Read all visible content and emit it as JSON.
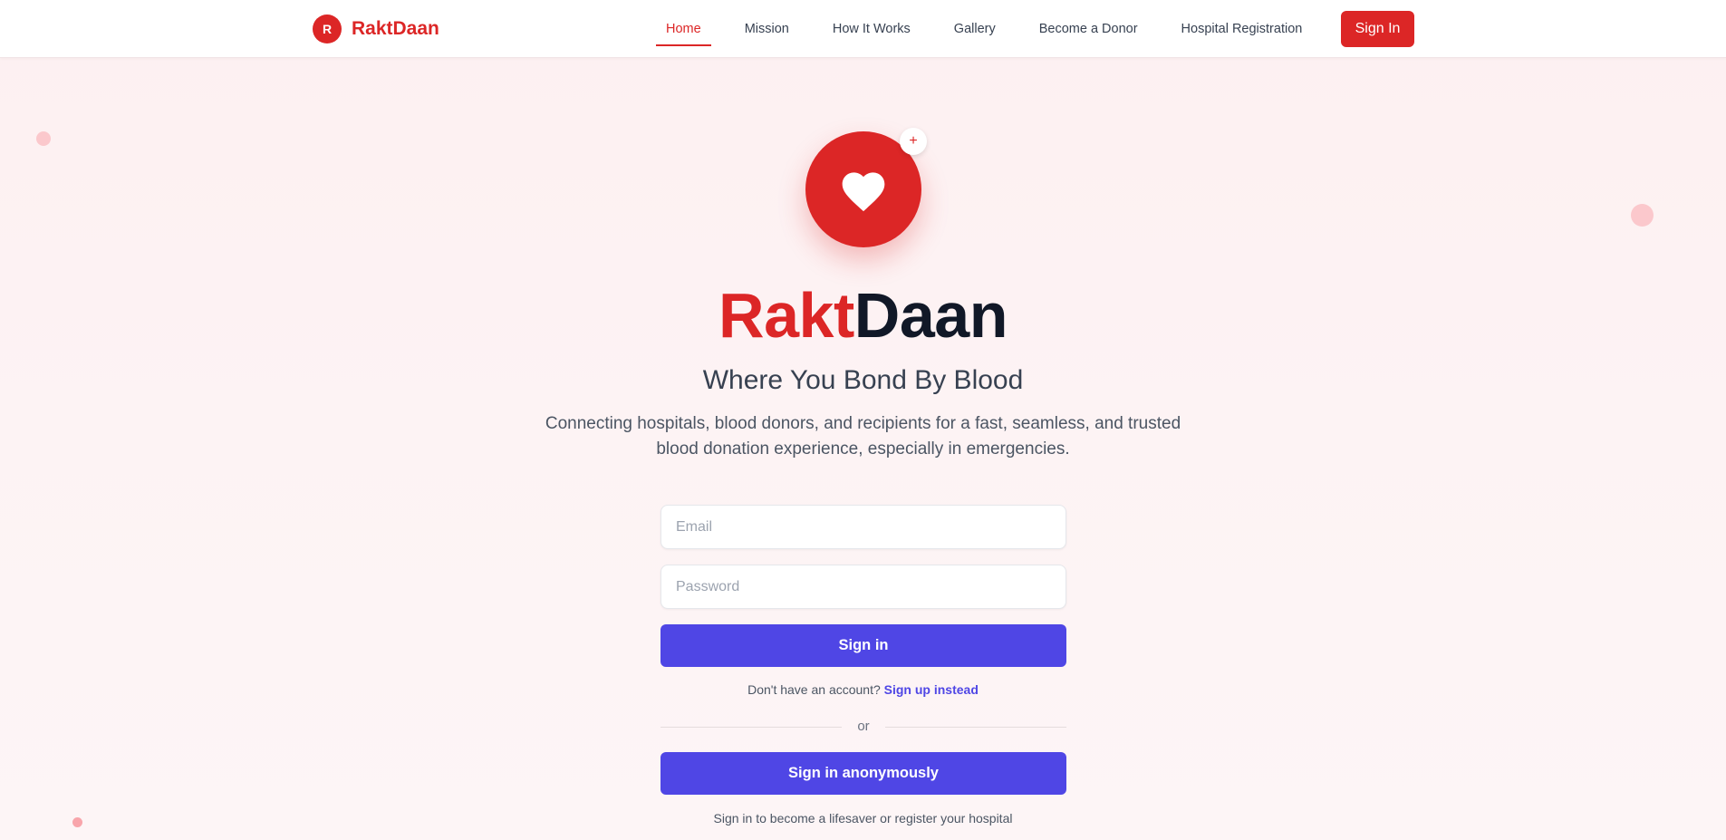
{
  "nav": {
    "brand_initial": "R",
    "brand_name": "RaktDaan",
    "links": [
      "Home",
      "Mission",
      "How It Works",
      "Gallery",
      "Become a Donor",
      "Hospital Registration"
    ],
    "active_link": "Home",
    "signin_label": "Sign In"
  },
  "hero": {
    "icon": "heart-icon",
    "badge_icon": "plus-icon",
    "badge_text": "+",
    "title_part1": "Rakt",
    "title_part2": "Daan",
    "tagline": "Where You Bond By Blood",
    "description": "Connecting hospitals, blood donors, and recipients for a fast, seamless, and trusted blood donation experience, especially in emergencies."
  },
  "form": {
    "email_placeholder": "Email",
    "password_placeholder": "Password",
    "signin_label": "Sign in",
    "no_account_text": "Don't have an account?",
    "signup_link": "Sign up instead",
    "divider_text": "or",
    "anon_signin_label": "Sign in anonymously",
    "footer_note": "Sign in to become a lifesaver or register your hospital"
  },
  "colors": {
    "brand_red": "#dc2626",
    "primary_button": "#4f46e5",
    "title_dark": "#111827"
  }
}
